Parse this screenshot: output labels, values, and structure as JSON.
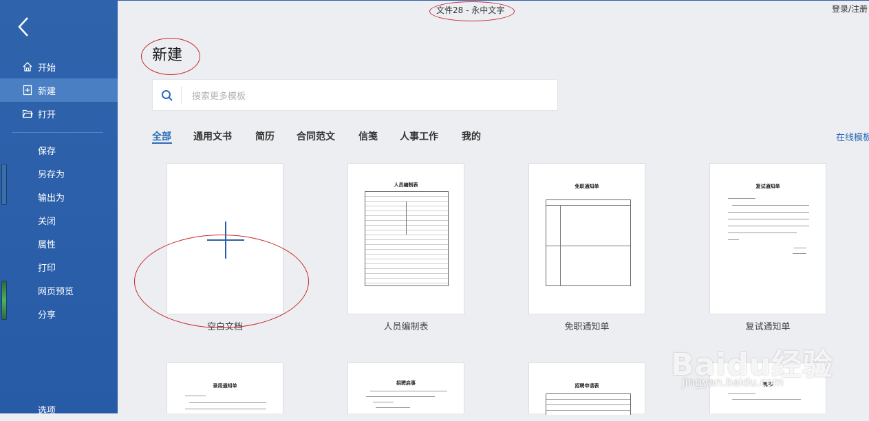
{
  "window": {
    "title": "文件28 - 永中文字",
    "login_link": "登录/注册"
  },
  "sidebar": {
    "top_items": [
      {
        "label": "开始",
        "icon": "home-icon"
      },
      {
        "label": "新建",
        "icon": "new-document-icon",
        "active": true
      },
      {
        "label": "打开",
        "icon": "open-folder-icon"
      }
    ],
    "items": [
      "保存",
      "另存为",
      "输出为",
      "关闭",
      "属性",
      "打印",
      "网页预览",
      "分享"
    ],
    "bottom_item": "选项"
  },
  "main": {
    "heading": "新建",
    "search": {
      "placeholder": "搜索更多模板",
      "value": ""
    },
    "tabs": [
      "全部",
      "通用文书",
      "简历",
      "合同范文",
      "信笺",
      "人事工作",
      "我的"
    ],
    "active_tab": "全部",
    "online_link": "在线模板",
    "templates": [
      {
        "label": "空白文档"
      },
      {
        "label": "人员编制表",
        "doc_title": "人员编制表"
      },
      {
        "label": "免职通知单",
        "doc_title": "免职通知单"
      },
      {
        "label": "复试通知单",
        "doc_title": "复试通知单"
      },
      {
        "label": "",
        "doc_title": "录用通知单"
      },
      {
        "label": "",
        "doc_title": "招聘启事"
      },
      {
        "label": "",
        "doc_title": "招聘申请表"
      },
      {
        "label": "",
        "doc_title": "聘书"
      }
    ]
  },
  "watermark": {
    "brand": "Baidu经验",
    "url": "jingyan.baidu.com"
  },
  "colors": {
    "sidebar": "#2a5ea8",
    "accent": "#2a6ab8",
    "annotation": "#c8282b"
  }
}
